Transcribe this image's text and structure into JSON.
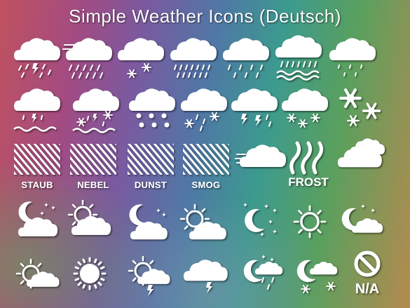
{
  "title": "Simple Weather Icons (Deutsch)",
  "labels": {
    "staub": "STAUB",
    "nebel": "NEBEL",
    "dunst": "DUNST",
    "smog": "SMOG",
    "frost": "FROST",
    "na": "N/A"
  },
  "icons": [
    "cloud-thunder-rain-icon",
    "cloud-wind-rain-icon",
    "cloud-snow-icon",
    "cloud-heavy-rain-icon",
    "cloud-light-rain-icon",
    "cloud-rain-waves-icon",
    "cloud-drizzle-icon",
    "cloud-rain-flood-icon",
    "cloud-sleet-flood-icon",
    "cloud-hail-icon",
    "cloud-snow-rain-icon",
    "cloud-thunderstorm-icon",
    "cloud-snowflakes-icon",
    "snowflakes-icon",
    "dust-icon",
    "fog-icon",
    "haze-icon",
    "smog-icon",
    "windy-cloud-icon",
    "frost-icon",
    "clouds-icon",
    "moon-stars-cloud-icon",
    "sun-clouds-icon",
    "moon-cloud-icon",
    "sun-cloud-icon",
    "moon-stars-icon",
    "sun-icon",
    "moon-cloud-small-icon",
    "sun-cloud-outline-icon",
    "sun-bright-icon",
    "sun-thunder-icon",
    "cloud-thunder-icon",
    "moon-cloud-rain-icon",
    "moon-cloud-snow-icon",
    "not-available-icon"
  ],
  "colors": {
    "icon": "#ffffff",
    "shadow": "#000000"
  }
}
